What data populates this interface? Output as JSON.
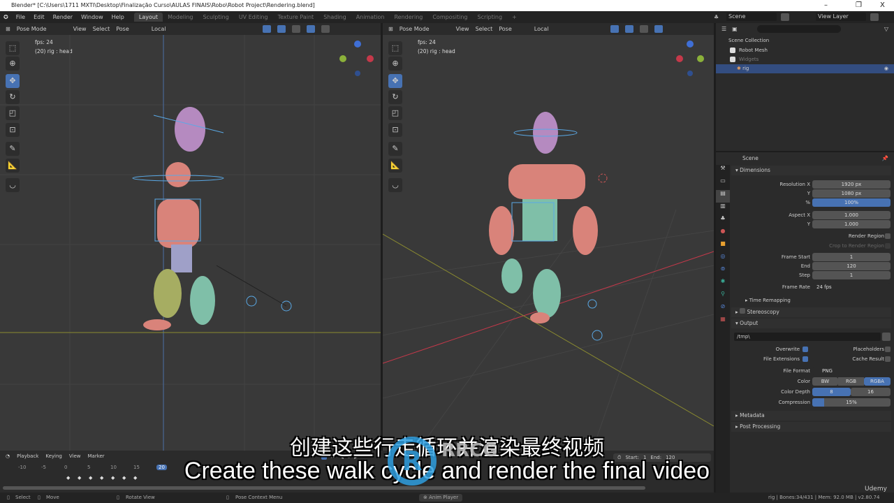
{
  "window": {
    "title": "Blender* [C:\\Users\\1711 MXTI\\Desktop\\Finalização Curso\\AULAS FINAIS\\Robo\\Robot Project\\Rendering.blend]",
    "minimize": "–",
    "maximize": "❐",
    "close": "X"
  },
  "menu": [
    "File",
    "Edit",
    "Render",
    "Window",
    "Help"
  ],
  "workspaces": [
    "Layout",
    "Modeling",
    "Sculpting",
    "UV Editing",
    "Texture Paint",
    "Shading",
    "Animation",
    "Rendering",
    "Compositing",
    "Scripting",
    "+"
  ],
  "scene": {
    "name": "Scene",
    "view_layer": "View Layer"
  },
  "viewport": {
    "mode": "Pose Mode",
    "menus": [
      "View",
      "Select",
      "Pose"
    ],
    "orientation": "Local",
    "fps": "fps: 24",
    "active": "(20) rig : head"
  },
  "outliner": {
    "search_placeholder": "",
    "items": [
      {
        "label": "Scene Collection"
      },
      {
        "label": "Robot Mesh",
        "checked": true
      },
      {
        "label": "Widgets",
        "checked": true,
        "dim": true
      },
      {
        "label": "rig",
        "selected": true
      }
    ]
  },
  "properties": {
    "header": "Scene",
    "dimensions": {
      "title": "Dimensions",
      "resolution_x_label": "Resolution X",
      "resolution_x": "1920 px",
      "y_label": "Y",
      "resolution_y": "1080 px",
      "pct_label": "%",
      "pct": "100%",
      "aspect_x_label": "Aspect X",
      "aspect_x": "1.000",
      "aspect_y": "1.000",
      "render_region": "Render Region",
      "crop": "Crop to Render Region",
      "frame_start_label": "Frame Start",
      "frame_start": "1",
      "end_label": "End",
      "end": "120",
      "step_label": "Step",
      "step": "1",
      "frame_rate_label": "Frame Rate",
      "frame_rate": "24 fps"
    },
    "time_remapping": "Time Remapping",
    "stereoscopy": "Stereoscopy",
    "output": {
      "title": "Output",
      "path": "/tmp\\",
      "overwrite": "Overwrite",
      "placeholders": "Placeholders",
      "file_extensions": "File Extensions",
      "cache_result": "Cache Result",
      "file_format_label": "File Format",
      "file_format": "PNG",
      "color_label": "Color",
      "color_options": [
        "BW",
        "RGB",
        "RGBA"
      ],
      "color_selected": "RGBA",
      "depth_label": "Color Depth",
      "depth_options": [
        "8",
        "16"
      ],
      "depth_selected": "8",
      "compression_label": "Compression",
      "compression": "15%",
      "compression_value": 15
    },
    "metadata": "Metadata",
    "post_processing": "Post Processing"
  },
  "timeline": {
    "menus": [
      "Playback",
      "Keying",
      "View",
      "Marker"
    ],
    "ticks": [
      "-10",
      "-5",
      "0",
      "5",
      "10",
      "15",
      "20"
    ],
    "current_frame": "20",
    "start_label": "Start:",
    "start": "1",
    "end_label": "End:",
    "end": "120"
  },
  "status": {
    "select": "Select",
    "move": "Move",
    "rotate": "Rotate View",
    "context": "Pose Context Menu",
    "anim_player": "Anim Player",
    "info": "rig | Bones:34/431 | Mem: 92.0 MB | v2.80.74"
  },
  "subtitles": {
    "zh": "创建这些行走循环并渲染最终视频",
    "en": "Create these walk cycle and render the final video"
  },
  "watermark": {
    "text": "RRCG",
    "sub": "人人素材",
    "udemy": "Udemy"
  },
  "colors": {
    "accent": "#4772b3",
    "bone": "#5aa9e6",
    "x_axis": "#c5394a",
    "y_axis": "#8bb13a"
  }
}
